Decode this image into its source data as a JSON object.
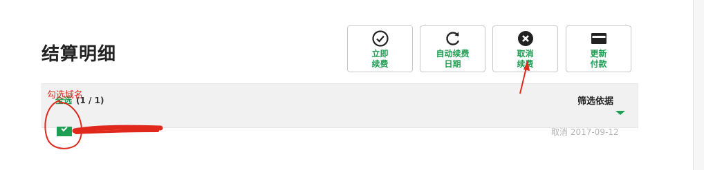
{
  "page": {
    "title": "结算明细"
  },
  "actions": [
    {
      "label": "立即\n续费",
      "icon": "check-circle-icon"
    },
    {
      "label": "自动续费\n日期",
      "icon": "refresh-icon"
    },
    {
      "label": "取消\n续费",
      "icon": "cancel-circle-icon"
    },
    {
      "label": "更新\n付款",
      "icon": "credit-card-icon"
    }
  ],
  "filter_bar": {
    "select_all_label": "全选",
    "selected_count": "(1 / 1)",
    "filter_label": "筛选依据"
  },
  "row": {
    "checked": true,
    "status_text": "取消 2017-09-12"
  },
  "annotation": {
    "text": "勾选域名",
    "color": "#e0281c"
  },
  "colors": {
    "accent": "#1e9e52",
    "title": "#222222",
    "muted": "#b5b5b5"
  }
}
